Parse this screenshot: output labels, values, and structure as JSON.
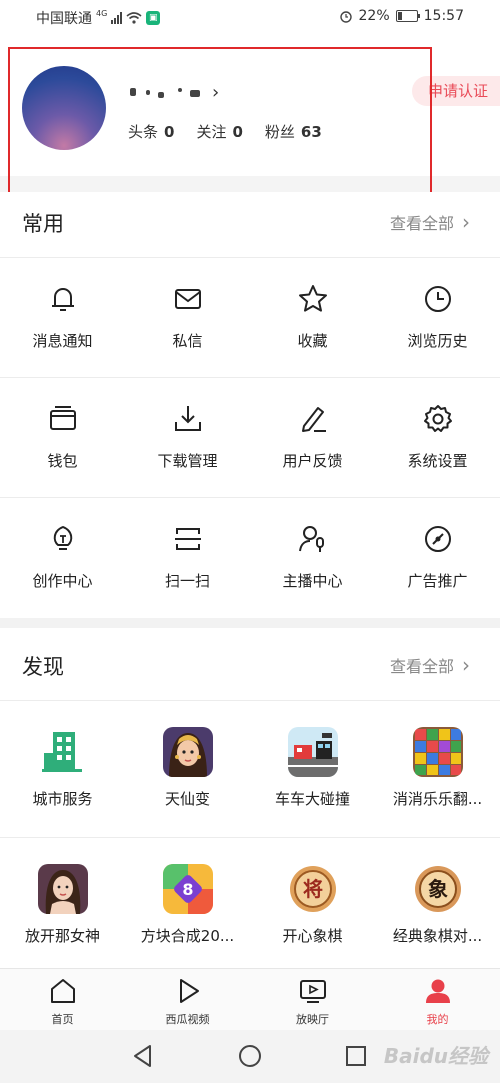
{
  "status_bar": {
    "carrier": "中国联通",
    "network": "4G",
    "battery_percent": "22%",
    "time": "15:57"
  },
  "profile": {
    "username_masked": true,
    "stats": [
      {
        "label": "头条",
        "value": "0"
      },
      {
        "label": "关注",
        "value": "0"
      },
      {
        "label": "粉丝",
        "value": "63"
      }
    ],
    "apply_button": "申请认证"
  },
  "common": {
    "title": "常用",
    "view_all": "查看全部",
    "items": [
      {
        "label": "消息通知",
        "icon": "bell-icon"
      },
      {
        "label": "私信",
        "icon": "mail-icon"
      },
      {
        "label": "收藏",
        "icon": "star-icon"
      },
      {
        "label": "浏览历史",
        "icon": "clock-icon"
      },
      {
        "label": "钱包",
        "icon": "wallet-icon"
      },
      {
        "label": "下载管理",
        "icon": "download-icon"
      },
      {
        "label": "用户反馈",
        "icon": "edit-icon"
      },
      {
        "label": "系统设置",
        "icon": "gear-icon"
      },
      {
        "label": "创作中心",
        "icon": "lightbulb-icon"
      },
      {
        "label": "扫一扫",
        "icon": "scan-icon"
      },
      {
        "label": "主播中心",
        "icon": "anchor-mic-icon"
      },
      {
        "label": "广告推广",
        "icon": "compass-icon"
      }
    ]
  },
  "discover": {
    "title": "发现",
    "view_all": "查看全部",
    "items": [
      {
        "label": "城市服务",
        "icon": "city-building-icon"
      },
      {
        "label": "天仙变",
        "icon": "game-character-icon"
      },
      {
        "label": "车车大碰撞",
        "icon": "car-crash-game-icon"
      },
      {
        "label": "消消乐乐翻...",
        "icon": "block-puzzle-icon"
      },
      {
        "label": "放开那女神",
        "icon": "goddess-game-icon"
      },
      {
        "label": "方块合成20...",
        "icon": "block-merge-icon"
      },
      {
        "label": "开心象棋",
        "icon": "chess-jiang-icon"
      },
      {
        "label": "经典象棋对...",
        "icon": "chess-xiang-icon"
      }
    ]
  },
  "tabbar": {
    "tabs": [
      {
        "label": "首页",
        "icon": "home-icon"
      },
      {
        "label": "西瓜视频",
        "icon": "play-icon"
      },
      {
        "label": "放映厅",
        "icon": "tv-icon"
      },
      {
        "label": "我的",
        "icon": "user-icon"
      }
    ],
    "active_color": "#e8404a"
  },
  "watermark": "Baidu经验",
  "colors": {
    "accent": "#e94b58",
    "highlight_box": "#e0292b"
  }
}
